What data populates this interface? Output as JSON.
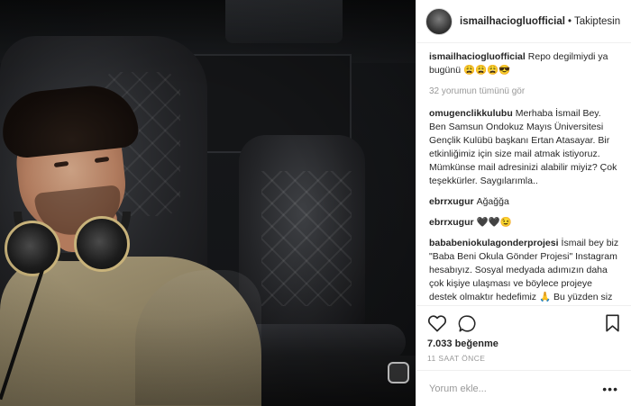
{
  "header": {
    "username": "ismailhaciogluofficial",
    "separator": "•",
    "follow_label": "Takiptesin"
  },
  "caption": {
    "username": "ismailhaciogluofficial",
    "text": "Repo degilmiydi ya bugünü 😩😩😩😎"
  },
  "load_more": "32 yorumun tümünü gör",
  "comments": [
    {
      "user": "omugenclikkulubu",
      "text": "Merhaba İsmail Bey. Ben Samsun Ondokuz Mayıs Üniversitesi Gençlik Kulübü başkanı Ertan Atasayar. Bir etkinliğimiz için size mail atmak istiyoruz. Mümkünse mail adresinizi alabilir miyiz? Çok teşekkürler. Saygılarımla.."
    },
    {
      "user": "ebrrxugur",
      "text": "Ağağğa"
    },
    {
      "user": "ebrrxugur",
      "text": "🖤🖤😉"
    },
    {
      "user": "bababeniokulagonderprojesi",
      "text": "İsmail bey biz \"Baba Beni Okula Gönder Projesi\" Instagram hesabıyız. Sosyal medyada adımızın daha çok kişiye ulaşması ve böylece projeye destek olmaktır hedefimiz 🙏 Bu yüzden siz değerli sanatçılarımızın ve yüksek takipçili kullanıcıların takibine ihtiyacımız var 🙏 Bizi takip ederek destek olabilirsiniz."
    }
  ],
  "likes": "7.033 beğenme",
  "timestamp": "11 SAAT ÖNCE",
  "add_comment": {
    "placeholder": "Yorum ekle...",
    "more": "•••"
  }
}
